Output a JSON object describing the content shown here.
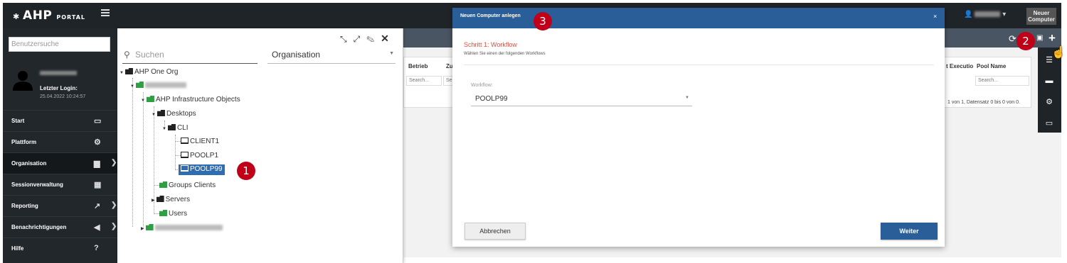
{
  "topbar": {
    "logo_main": "AHP",
    "logo_sub": "PORTAL",
    "new_computer_line1": "Neuer",
    "new_computer_line2": "Computer"
  },
  "sidebar": {
    "search_placeholder": "Benutzersuche",
    "last_login_label": "Letzter Login:",
    "last_login_date": "25.04.2022 10:24:57",
    "items": [
      {
        "label": "Start",
        "icon": "monitor-icon"
      },
      {
        "label": "Plattform",
        "icon": "gears-icon"
      },
      {
        "label": "Organisation",
        "icon": "building-icon"
      },
      {
        "label": "Sessionverwaltung",
        "icon": "sessions-icon"
      },
      {
        "label": "Reporting",
        "icon": "chart-icon"
      },
      {
        "label": "Benachrichtigungen",
        "icon": "megaphone-icon"
      },
      {
        "label": "Hilfe",
        "icon": "question-icon"
      }
    ]
  },
  "tree": {
    "search_placeholder": "Suchen",
    "org_select": "Organisation",
    "nodes": {
      "root": "AHP One Org",
      "infra": "AHP Infrastructure Objects",
      "desktops": "Desktops",
      "cli": "CLI",
      "client1": "CLIENT1",
      "poolp1": "POOLP1",
      "poolp99": "POOLP99",
      "groups_clients": "Groups Clients",
      "servers": "Servers",
      "users": "Users"
    }
  },
  "background": {
    "col_betrieb": "Betrieb",
    "col_zu": "Zu",
    "col_exec": "t Executio",
    "col_pool": "Pool Name",
    "search1": "Search...",
    "search2": "Se",
    "search3": "Search...",
    "pageinfo": "1 von 1, Datensatz 0 bis 0 von 0."
  },
  "modal": {
    "title": "Neuen Computer anlegen",
    "close": "×",
    "step_title": "Schritt 1: Workflow",
    "step_subtitle": "Wählen Sie einen der folgenden Workflows",
    "workflow_label": "Workflow:",
    "workflow_value": "POOLP99",
    "cancel_label": "Abbrechen",
    "next_label": "Weiter"
  },
  "callouts": [
    "1",
    "2",
    "3"
  ]
}
